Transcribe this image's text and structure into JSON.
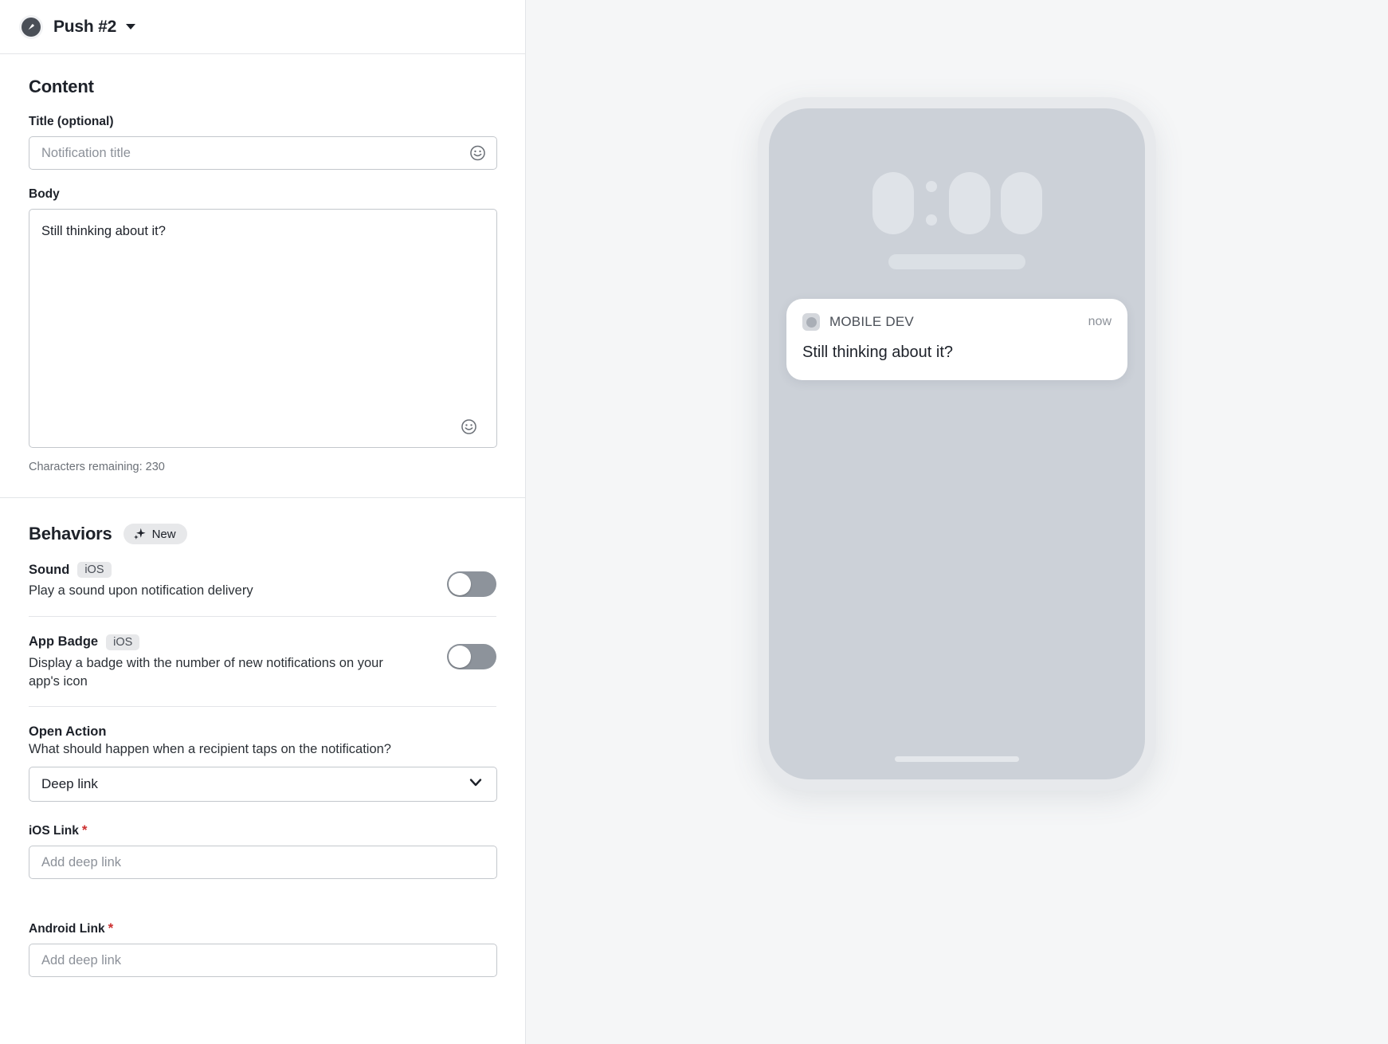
{
  "header": {
    "icon": "push-notification-icon",
    "title": "Push #2",
    "caret": "chevron-down-icon"
  },
  "content_section": {
    "title": "Content",
    "title_field": {
      "label": "Title (optional)",
      "placeholder": "Notification title",
      "value": "",
      "emoji_icon": "emoji-smiley-icon"
    },
    "body_field": {
      "label": "Body",
      "value": "Still thinking about it?",
      "placeholder": "",
      "emoji_icon": "emoji-smiley-icon"
    },
    "chars_remaining": "Characters remaining: 230"
  },
  "behaviors_section": {
    "title": "Behaviors",
    "badge": {
      "label": "New",
      "icon": "sparkles-icon"
    },
    "rows": [
      {
        "title": "Sound",
        "platform": "iOS",
        "description": "Play a sound upon notification delivery",
        "toggle_state": "off"
      },
      {
        "title": "App Badge",
        "platform": "iOS",
        "description": "Display a badge with the number of new notifications on your app's icon",
        "toggle_state": "off"
      }
    ],
    "open_action": {
      "title": "Open Action",
      "description": "What should happen when a recipient taps on the notification?",
      "selected": "Deep link",
      "options": [
        "Deep link"
      ],
      "chevron_icon": "chevron-down-icon"
    },
    "ios_link": {
      "label": "iOS Link",
      "required_marker": "*",
      "placeholder": "Add deep link",
      "value": ""
    },
    "android_link": {
      "label": "Android Link",
      "required_marker": "*",
      "placeholder": "Add deep link",
      "value": ""
    }
  },
  "preview": {
    "notification": {
      "app_name": "MOBILE DEV",
      "time": "now",
      "body": "Still thinking about it?"
    }
  },
  "colors": {
    "panel_background": "#ffffff",
    "preview_background": "#f5f6f7",
    "phone_bezel": "#e7e9ec",
    "phone_screen": "#ccd1d8",
    "text_primary": "#1d2129",
    "text_muted": "#6b7077",
    "border": "#c3c7cc",
    "toggle_off": "#8d939b",
    "required_star": "#cc2f2f",
    "badge_background": "#e7e8ea"
  }
}
